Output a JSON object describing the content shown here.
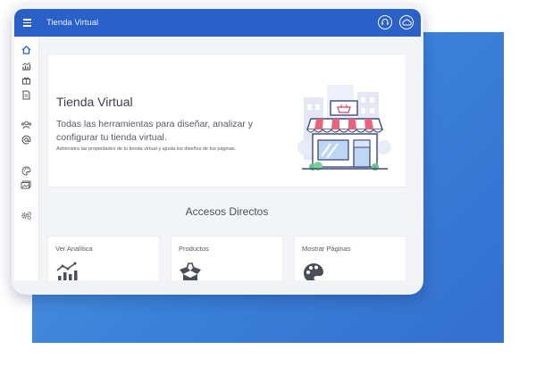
{
  "window": {
    "title": "Tienda Virtual"
  },
  "header_icons": [
    "support-icon",
    "cloud-icon"
  ],
  "sidebar_icons": [
    "home-icon",
    "analytics-icon",
    "gift-icon",
    "document-icon",
    "users-icon",
    "at-icon",
    "palette-icon",
    "image-icon",
    "settings-icon"
  ],
  "hero": {
    "title": "Tienda Virtual",
    "subtitle": "Todas las herramientas para diseñar, analizar y configurar tu tienda virtual.",
    "description": "Administra las propiedades de tu tienda virtual y ajusta los diseños de tus páginas."
  },
  "shortcuts": {
    "title": "Accesos Directos",
    "cards": [
      {
        "label": "Ver Analítica",
        "icon": "analytics-chart-icon"
      },
      {
        "label": "Productos",
        "icon": "open-box-icon"
      },
      {
        "label": "Mostrar Páginas",
        "icon": "palette-icon"
      }
    ]
  },
  "colors": {
    "accent": "#2a61c8",
    "background_panel": "#3a7fd8"
  }
}
